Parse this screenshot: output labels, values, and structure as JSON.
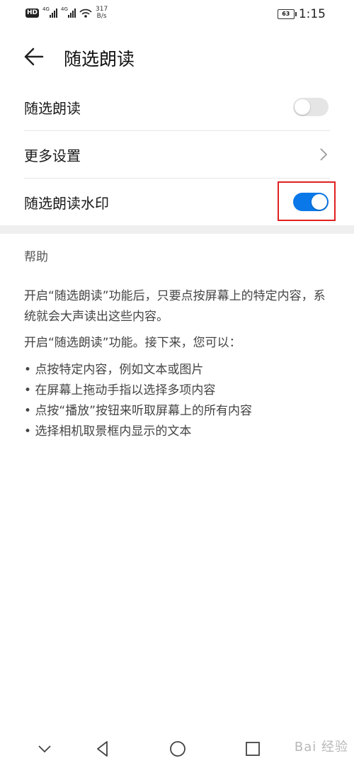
{
  "status_bar": {
    "net_speed": "317",
    "net_unit": "B/s",
    "signal_tag_1": "4G",
    "signal_tag_2": "4G",
    "hd_badge": "HD",
    "battery": "63",
    "time": "1:15"
  },
  "header": {
    "title": "随选朗读"
  },
  "settings": [
    {
      "label": "随选朗读",
      "control": "toggle",
      "on": false
    },
    {
      "label": "更多设置",
      "control": "chevron"
    },
    {
      "label": "随选朗读水印",
      "control": "toggle",
      "on": true
    }
  ],
  "help": {
    "title": "帮助",
    "para1": "开启“随选朗读”功能后，只要点按屏幕上的特定内容，系统就会大声读出这些内容。",
    "para2": "开启“随选朗读”功能。接下来，您可以：",
    "bullets": [
      "点按特定内容，例如文本或图片",
      "在屏幕上拖动手指以选择多项内容",
      "点按“播放”按钮来听取屏幕上的所有内容",
      "选择相机取景框内显示的文本"
    ]
  },
  "watermark": "Bai 经验",
  "colors": {
    "accent": "#0a78e8",
    "highlight": "#e02020"
  }
}
